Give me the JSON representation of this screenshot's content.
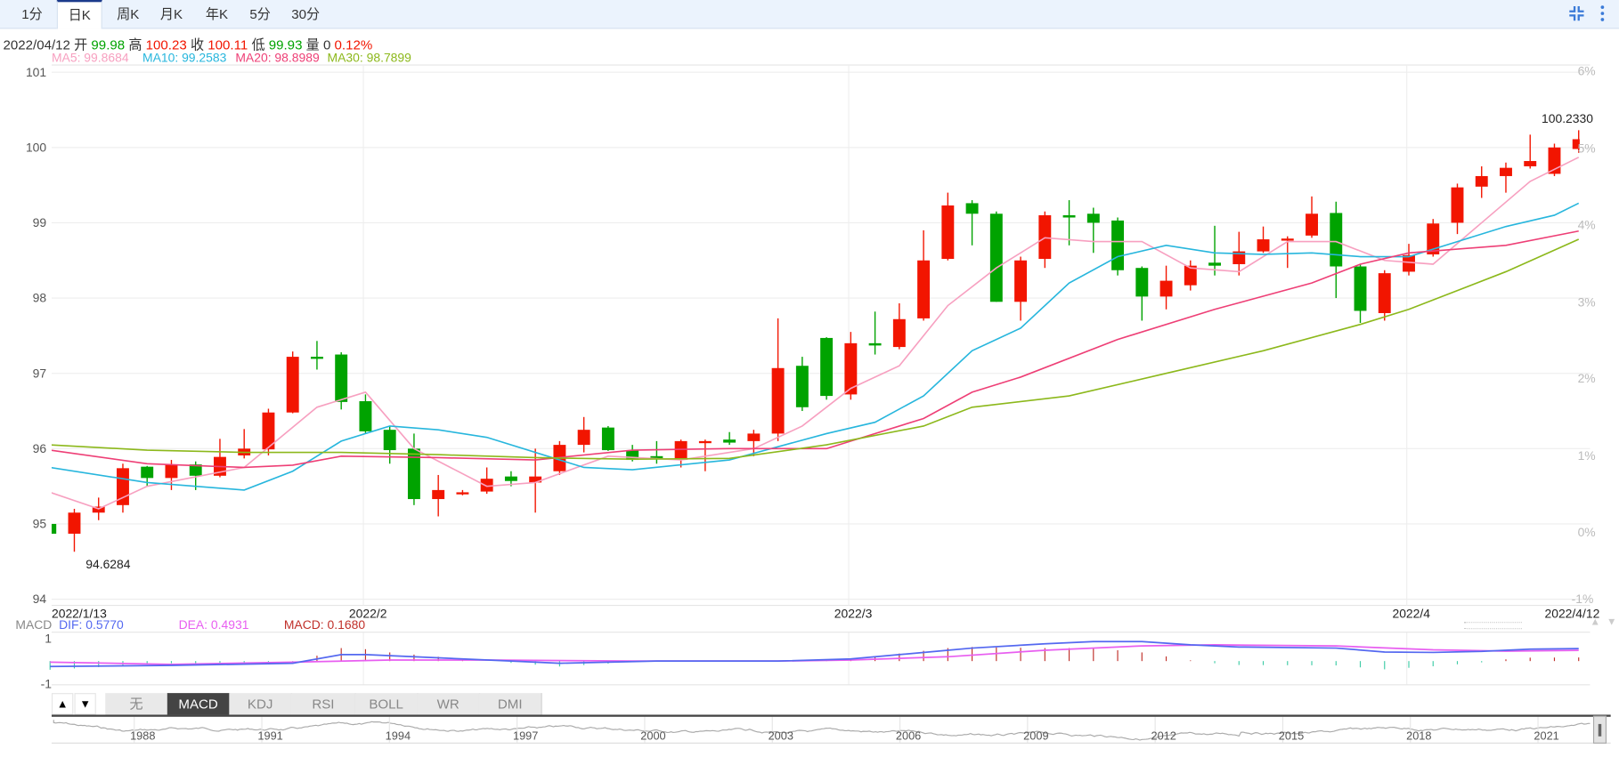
{
  "period_tabs": [
    "1分",
    "日K",
    "周K",
    "月K",
    "年K",
    "5分",
    "30分"
  ],
  "active_period": "日K",
  "toolbar": {
    "collapse_icon": "collapse-arrows-icon",
    "menu_icon": "vertical-dots-icon"
  },
  "quote": {
    "date": "2022/04/12",
    "open_label": "开",
    "open": "99.98",
    "high_label": "高",
    "high": "100.23",
    "close_label": "收",
    "close": "100.11",
    "low_label": "低",
    "low": "99.93",
    "volume_label": "量",
    "volume": "0",
    "change": "0.12%"
  },
  "ma_legend": [
    {
      "text": "MA5: 99.8684",
      "color": "#f7a0c0"
    },
    {
      "text": "MA10: 99.2583",
      "color": "#27b6dd"
    },
    {
      "text": "MA20: 98.8989",
      "color": "#ee3f76"
    },
    {
      "text": "MA30: 98.7899",
      "color": "#8cb81b"
    }
  ],
  "colors": {
    "up": "#f21500",
    "down": "#00a300",
    "macd_pos": "#c0302a",
    "macd_neg": "#3fcca6",
    "dif": "#5468f0",
    "dea": "#e85ef0"
  },
  "chart_data": {
    "type": "candlestick",
    "ylim": [
      94,
      101
    ],
    "y_ticks": [
      "101",
      "100",
      "99",
      "98",
      "97",
      "96",
      "95",
      "94"
    ],
    "pct_ticks": [
      "6%",
      "5%",
      "4%",
      "3%",
      "2%",
      "1%",
      "0%",
      "-1%"
    ],
    "x_labels": [
      {
        "text": "2022/1/13",
        "index": 0
      },
      {
        "text": "2022/2",
        "index": 13
      },
      {
        "text": "2022/3",
        "index": 33
      },
      {
        "text": "2022/4",
        "index": 56
      },
      {
        "text": "2022/4/12",
        "index": 63
      }
    ],
    "max_label": "100.2330",
    "min_label": "94.6284",
    "ohlc": [
      [
        95.0,
        95.0,
        94.85,
        94.87
      ],
      [
        94.87,
        95.2,
        94.63,
        95.15
      ],
      [
        95.15,
        95.35,
        95.05,
        95.23
      ],
      [
        95.25,
        95.8,
        95.15,
        95.74
      ],
      [
        95.76,
        95.77,
        95.5,
        95.61
      ],
      [
        95.61,
        95.85,
        95.45,
        95.79
      ],
      [
        95.79,
        95.83,
        95.45,
        95.64
      ],
      [
        95.64,
        96.13,
        95.62,
        95.89
      ],
      [
        95.91,
        96.26,
        95.87,
        96.0
      ],
      [
        95.99,
        96.53,
        95.91,
        96.48
      ],
      [
        96.48,
        97.29,
        96.47,
        97.22
      ],
      [
        97.22,
        97.43,
        97.05,
        97.2
      ],
      [
        97.25,
        97.28,
        96.52,
        96.62
      ],
      [
        96.63,
        96.72,
        96.2,
        96.23
      ],
      [
        96.25,
        96.3,
        95.8,
        95.98
      ],
      [
        96.0,
        96.2,
        95.25,
        95.33
      ],
      [
        95.33,
        95.65,
        95.1,
        95.45
      ],
      [
        95.4,
        95.45,
        95.38,
        95.42
      ],
      [
        95.43,
        95.75,
        95.4,
        95.6
      ],
      [
        95.63,
        95.7,
        95.5,
        95.57
      ],
      [
        95.55,
        96.0,
        95.15,
        95.63
      ],
      [
        95.7,
        96.1,
        95.65,
        96.05
      ],
      [
        96.05,
        96.42,
        95.95,
        96.25
      ],
      [
        96.28,
        96.3,
        95.97,
        95.98
      ],
      [
        95.98,
        96.05,
        95.83,
        95.85
      ],
      [
        95.9,
        96.1,
        95.8,
        95.89
      ],
      [
        95.85,
        96.12,
        95.75,
        96.1
      ],
      [
        96.08,
        96.12,
        95.7,
        96.1
      ],
      [
        96.12,
        96.22,
        96.05,
        96.08
      ],
      [
        96.1,
        96.25,
        95.9,
        96.2
      ],
      [
        96.2,
        97.73,
        96.1,
        97.07
      ],
      [
        97.1,
        97.22,
        96.5,
        96.55
      ],
      [
        97.47,
        97.48,
        96.65,
        96.7
      ],
      [
        96.72,
        97.55,
        96.65,
        97.4
      ],
      [
        97.4,
        97.82,
        97.25,
        97.37
      ],
      [
        97.35,
        97.93,
        97.32,
        97.72
      ],
      [
        97.73,
        98.9,
        97.7,
        98.5
      ],
      [
        98.52,
        99.4,
        98.5,
        99.23
      ],
      [
        99.26,
        99.3,
        98.7,
        99.12
      ],
      [
        99.12,
        99.15,
        97.95,
        97.95
      ],
      [
        97.95,
        98.55,
        97.7,
        98.5
      ],
      [
        98.52,
        99.15,
        98.4,
        99.1
      ],
      [
        99.1,
        99.3,
        98.7,
        99.07
      ],
      [
        99.12,
        99.2,
        98.6,
        99.0
      ],
      [
        99.03,
        99.07,
        98.3,
        98.37
      ],
      [
        98.4,
        98.42,
        97.7,
        98.02
      ],
      [
        98.02,
        98.43,
        97.85,
        98.23
      ],
      [
        98.17,
        98.5,
        98.1,
        98.43
      ],
      [
        98.47,
        98.96,
        98.3,
        98.43
      ],
      [
        98.45,
        98.88,
        98.3,
        98.62
      ],
      [
        98.62,
        98.95,
        98.6,
        98.78
      ],
      [
        98.78,
        98.82,
        98.4,
        98.79
      ],
      [
        98.83,
        99.35,
        98.8,
        99.12
      ],
      [
        99.13,
        99.28,
        98.0,
        98.42
      ],
      [
        98.42,
        98.45,
        97.67,
        97.83
      ],
      [
        97.8,
        98.37,
        97.7,
        98.33
      ],
      [
        98.35,
        98.72,
        98.3,
        98.57
      ],
      [
        98.58,
        99.05,
        98.55,
        98.99
      ],
      [
        99.0,
        99.52,
        98.85,
        99.47
      ],
      [
        99.48,
        99.75,
        99.33,
        99.62
      ],
      [
        99.62,
        99.8,
        99.4,
        99.73
      ],
      [
        99.75,
        100.17,
        99.72,
        99.82
      ],
      [
        99.65,
        100.05,
        99.62,
        100.0
      ],
      [
        99.98,
        100.23,
        99.93,
        100.11
      ]
    ],
    "ma": {
      "MA5": [
        [
          0,
          95.42
        ],
        [
          2,
          95.2
        ],
        [
          4,
          95.5
        ],
        [
          8,
          95.75
        ],
        [
          11,
          96.55
        ],
        [
          13,
          96.75
        ],
        [
          15,
          96.0
        ],
        [
          18,
          95.5
        ],
        [
          20,
          95.55
        ],
        [
          23,
          95.9
        ],
        [
          26,
          95.85
        ],
        [
          29,
          96.0
        ],
        [
          31,
          96.3
        ],
        [
          33,
          96.8
        ],
        [
          35,
          97.1
        ],
        [
          37,
          97.9
        ],
        [
          39,
          98.4
        ],
        [
          41,
          98.8
        ],
        [
          43,
          98.75
        ],
        [
          45,
          98.75
        ],
        [
          47,
          98.4
        ],
        [
          49,
          98.35
        ],
        [
          51,
          98.75
        ],
        [
          53,
          98.75
        ],
        [
          55,
          98.5
        ],
        [
          57,
          98.45
        ],
        [
          59,
          99.0
        ],
        [
          61,
          99.55
        ],
        [
          63,
          99.87
        ]
      ],
      "MA10": [
        [
          0,
          95.75
        ],
        [
          4,
          95.55
        ],
        [
          8,
          95.45
        ],
        [
          10,
          95.7
        ],
        [
          12,
          96.1
        ],
        [
          14,
          96.3
        ],
        [
          16,
          96.25
        ],
        [
          18,
          96.15
        ],
        [
          20,
          95.95
        ],
        [
          22,
          95.75
        ],
        [
          24,
          95.72
        ],
        [
          28,
          95.85
        ],
        [
          32,
          96.2
        ],
        [
          34,
          96.35
        ],
        [
          36,
          96.7
        ],
        [
          38,
          97.3
        ],
        [
          40,
          97.6
        ],
        [
          42,
          98.2
        ],
        [
          44,
          98.55
        ],
        [
          46,
          98.7
        ],
        [
          48,
          98.6
        ],
        [
          50,
          98.58
        ],
        [
          52,
          98.6
        ],
        [
          54,
          98.55
        ],
        [
          56,
          98.55
        ],
        [
          58,
          98.75
        ],
        [
          60,
          98.95
        ],
        [
          62,
          99.1
        ],
        [
          63,
          99.26
        ]
      ],
      "MA20": [
        [
          0,
          95.98
        ],
        [
          4,
          95.8
        ],
        [
          8,
          95.75
        ],
        [
          10,
          95.78
        ],
        [
          12,
          95.9
        ],
        [
          16,
          95.88
        ],
        [
          20,
          95.85
        ],
        [
          24,
          95.98
        ],
        [
          28,
          96.0
        ],
        [
          32,
          96.0
        ],
        [
          36,
          96.4
        ],
        [
          38,
          96.75
        ],
        [
          40,
          96.95
        ],
        [
          44,
          97.45
        ],
        [
          48,
          97.85
        ],
        [
          52,
          98.2
        ],
        [
          54,
          98.45
        ],
        [
          56,
          98.6
        ],
        [
          60,
          98.7
        ],
        [
          63,
          98.89
        ]
      ],
      "MA30": [
        [
          0,
          96.05
        ],
        [
          4,
          95.98
        ],
        [
          8,
          95.95
        ],
        [
          12,
          95.95
        ],
        [
          16,
          95.92
        ],
        [
          20,
          95.88
        ],
        [
          24,
          95.86
        ],
        [
          28,
          95.87
        ],
        [
          32,
          96.05
        ],
        [
          36,
          96.3
        ],
        [
          38,
          96.55
        ],
        [
          42,
          96.7
        ],
        [
          46,
          97.0
        ],
        [
          50,
          97.3
        ],
        [
          54,
          97.65
        ],
        [
          56,
          97.85
        ],
        [
          60,
          98.35
        ],
        [
          63,
          98.78
        ]
      ]
    }
  },
  "macd": {
    "label": "MACD",
    "dif_text": "DIF: 0.5770",
    "dea_text": "DEA: 0.4931",
    "macd_text": "MACD: 0.1680",
    "y_ticks": [
      "1",
      "-1"
    ],
    "dif": [
      [
        0,
        -0.25
      ],
      [
        5,
        -0.2
      ],
      [
        10,
        -0.1
      ],
      [
        12,
        0.3
      ],
      [
        13,
        0.3
      ],
      [
        16,
        0.15
      ],
      [
        19,
        0.0
      ],
      [
        21,
        -0.1
      ],
      [
        23,
        -0.05
      ],
      [
        25,
        0.0
      ],
      [
        30,
        0.0
      ],
      [
        33,
        0.1
      ],
      [
        35,
        0.3
      ],
      [
        37,
        0.5
      ],
      [
        38,
        0.6
      ],
      [
        41,
        0.8
      ],
      [
        43,
        0.9
      ],
      [
        45,
        0.9
      ],
      [
        47,
        0.75
      ],
      [
        49,
        0.65
      ],
      [
        53,
        0.6
      ],
      [
        55,
        0.42
      ],
      [
        57,
        0.4
      ],
      [
        59,
        0.45
      ],
      [
        61,
        0.55
      ],
      [
        63,
        0.577
      ]
    ],
    "dea": [
      [
        0,
        -0.05
      ],
      [
        5,
        -0.15
      ],
      [
        10,
        -0.05
      ],
      [
        14,
        0.05
      ],
      [
        18,
        0.05
      ],
      [
        24,
        0.0
      ],
      [
        30,
        0.0
      ],
      [
        33,
        0.05
      ],
      [
        37,
        0.2
      ],
      [
        41,
        0.5
      ],
      [
        45,
        0.7
      ],
      [
        48,
        0.75
      ],
      [
        53,
        0.7
      ],
      [
        57,
        0.52
      ],
      [
        60,
        0.46
      ],
      [
        63,
        0.4931
      ]
    ]
  },
  "indicator_tabs": [
    "无",
    "MACD",
    "KDJ",
    "RSI",
    "BOLL",
    "WR",
    "DMI"
  ],
  "active_indicator": "MACD",
  "scroll_buttons": {
    "up": "▲",
    "down": "▼"
  },
  "navigator_years": [
    "1988",
    "1991",
    "1994",
    "1997",
    "2000",
    "2003",
    "2006",
    "2009",
    "2012",
    "2015",
    "2018",
    "2021"
  ]
}
